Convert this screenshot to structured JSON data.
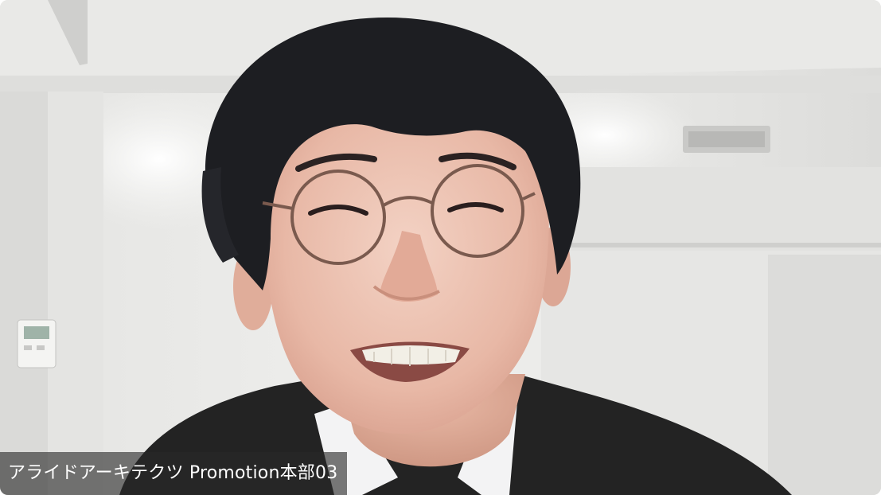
{
  "video_tile": {
    "participant_name": "アライドアーキテクツ Promotion本部03",
    "participant_icon": "webcam-video-feed"
  }
}
